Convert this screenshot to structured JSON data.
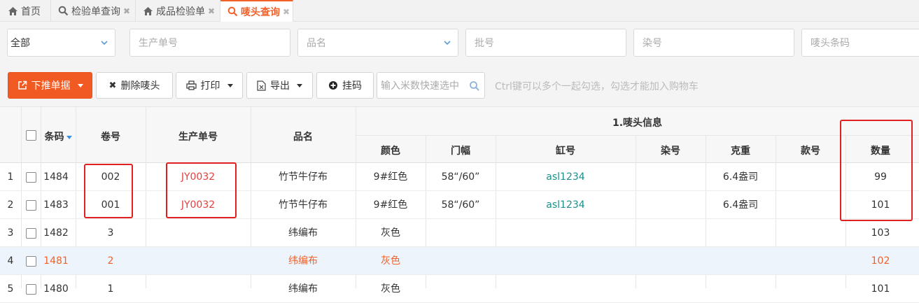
{
  "tabs": [
    {
      "label": "首页",
      "icon": "home-icon",
      "closable": false
    },
    {
      "label": "检验单查询",
      "icon": "search-icon",
      "closable": true
    },
    {
      "label": "成品检验单",
      "icon": "home-icon",
      "closable": true
    },
    {
      "label": "唛头查询",
      "icon": "search-icon",
      "closable": true,
      "active": true
    }
  ],
  "filters": {
    "status_select": "全部",
    "production_no_placeholder": "生产单号",
    "product_name_placeholder": "品名",
    "batch_no_placeholder": "批号",
    "dye_no_placeholder": "染号",
    "mark_barcode_placeholder": "唛头条码"
  },
  "toolbar": {
    "push_down_label": "下推单据",
    "delete_label": "删除唛头",
    "print_label": "打印",
    "export_label": "导出",
    "hang_label": "挂码",
    "quick_select_placeholder": "输入米数快速选中",
    "hint": "Ctrl键可以多个一起勾选，勾选才能加入购物车"
  },
  "table": {
    "group_header": "1.唛头信息",
    "columns": {
      "barcode": "条码",
      "roll_no": "卷号",
      "production_no": "生产单号",
      "product_name": "品名",
      "color": "颜色",
      "width": "门幅",
      "vat_no": "缸号",
      "dye_no": "染号",
      "weight": "克重",
      "style_no": "款号",
      "quantity": "数量"
    },
    "rows": [
      {
        "idx": "1",
        "barcode": "1484",
        "roll_no": "002",
        "production_no": "JY0032",
        "product_name": "竹节牛仔布",
        "color": "9#红色",
        "width": "58“/60”",
        "vat_no": "asl1234",
        "dye_no": "",
        "weight": "6.4盎司",
        "style_no": "",
        "quantity": "99"
      },
      {
        "idx": "2",
        "barcode": "1483",
        "roll_no": "001",
        "production_no": "JY0032",
        "product_name": "竹节牛仔布",
        "color": "9#红色",
        "width": "58“/60”",
        "vat_no": "asl1234",
        "dye_no": "",
        "weight": "6.4盎司",
        "style_no": "",
        "quantity": "101"
      },
      {
        "idx": "3",
        "barcode": "1482",
        "roll_no": "3",
        "production_no": "",
        "product_name": "纬编布",
        "color": "灰色",
        "width": "",
        "vat_no": "",
        "dye_no": "",
        "weight": "",
        "style_no": "",
        "quantity": "103"
      },
      {
        "idx": "4",
        "barcode": "1481",
        "roll_no": "2",
        "production_no": "",
        "product_name": "纬编布",
        "color": "灰色",
        "width": "",
        "vat_no": "",
        "dye_no": "",
        "weight": "",
        "style_no": "",
        "quantity": "102"
      },
      {
        "idx": "5",
        "barcode": "1480",
        "roll_no": "1",
        "production_no": "",
        "product_name": "纬编布",
        "color": "灰色",
        "width": "",
        "vat_no": "",
        "dye_no": "",
        "weight": "",
        "style_no": "",
        "quantity": "101"
      }
    ]
  },
  "colors": {
    "accent": "#f15a22",
    "highlight_row": "#edf4fb",
    "annotation_box": "#e02020",
    "link_teal": "#1e8f8a"
  }
}
